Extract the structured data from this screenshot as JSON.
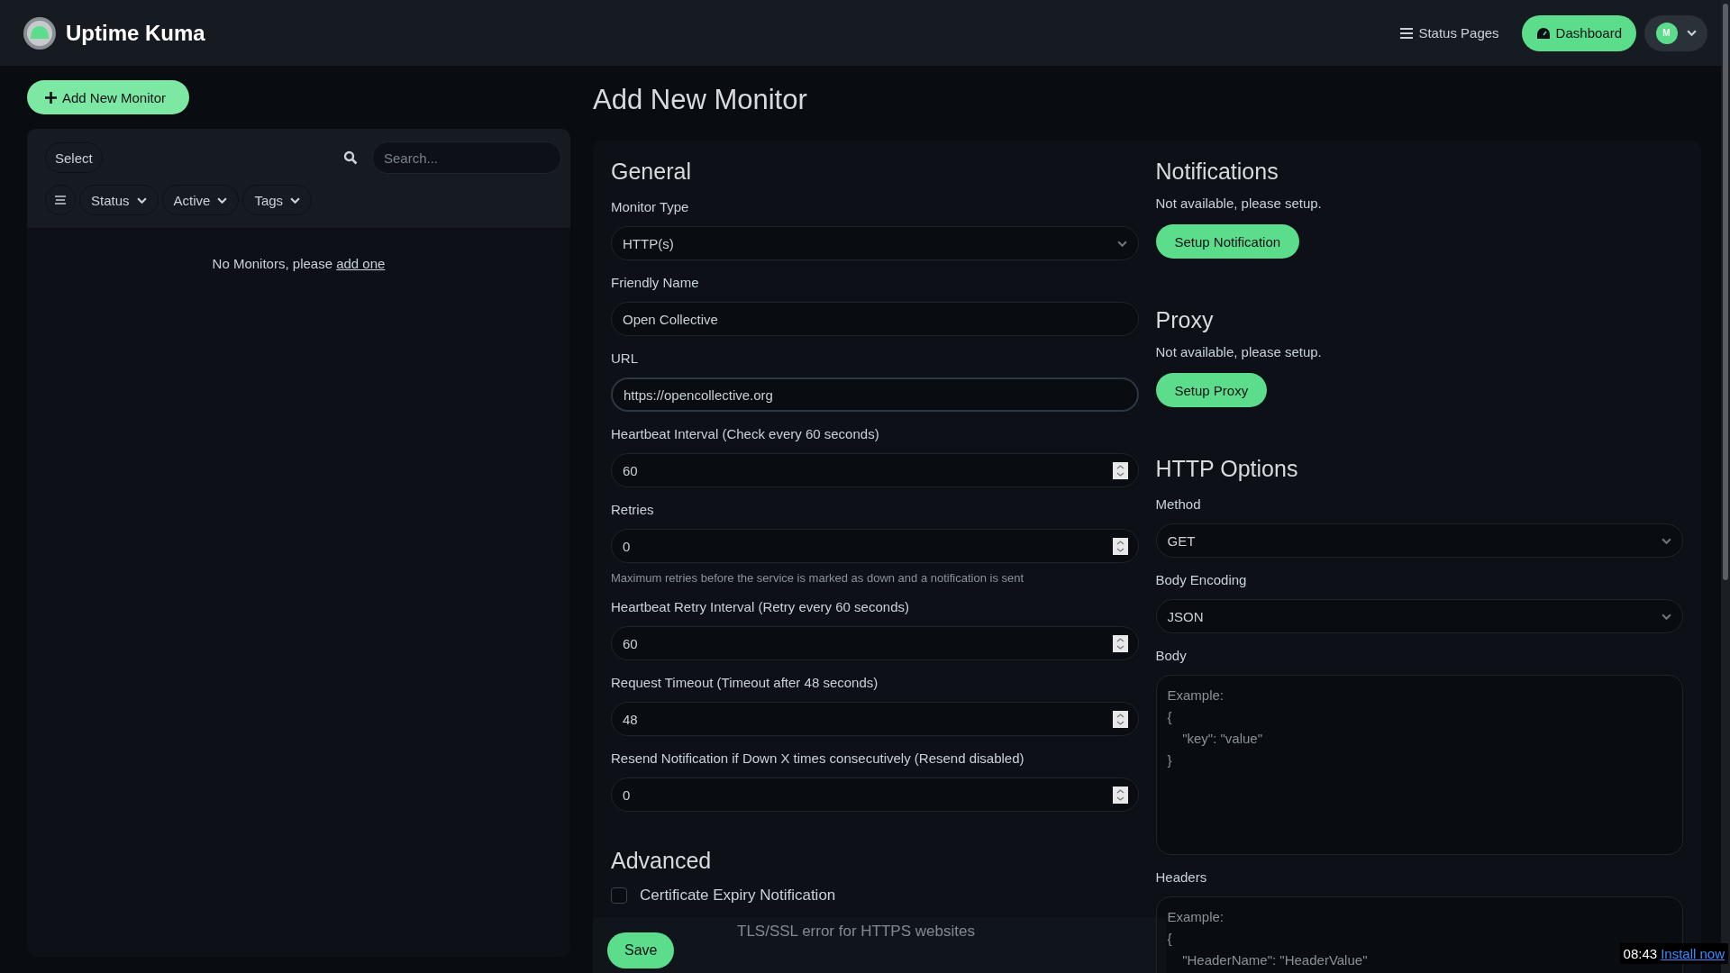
{
  "header": {
    "brand": "Uptime Kuma",
    "status_pages": "Status Pages",
    "dashboard": "Dashboard",
    "avatar": "M"
  },
  "sidebar": {
    "add_button": "Add New Monitor",
    "select_button": "Select",
    "search": {
      "placeholder": "Search..."
    },
    "filters": [
      "Status",
      "Active",
      "Tags"
    ],
    "empty_text": "No Monitors, please",
    "empty_link": "add one"
  },
  "page_title": "Add New Monitor",
  "general": {
    "heading": "General",
    "fields": [
      {
        "label": "Monitor Type",
        "kind": "select",
        "value": "HTTP(s)"
      },
      {
        "label": "Friendly Name",
        "kind": "text",
        "value": "Open Collective"
      },
      {
        "label": "URL",
        "kind": "text",
        "value": "https://opencollective.org",
        "focused": true
      },
      {
        "label": "Heartbeat Interval (Check every 60 seconds)",
        "kind": "number",
        "value": "60"
      },
      {
        "label": "Retries",
        "kind": "number",
        "value": "0",
        "hint": "Maximum retries before the service is marked as down and a notification is sent"
      },
      {
        "label": "Heartbeat Retry Interval (Retry every 60 seconds)",
        "kind": "number",
        "value": "60"
      },
      {
        "label": "Request Timeout (Timeout after 48 seconds)",
        "kind": "number",
        "value": "48"
      },
      {
        "label": "Resend Notification if Down X times consecutively (Resend disabled)",
        "kind": "number",
        "value": "0"
      }
    ]
  },
  "advanced": {
    "heading": "Advanced",
    "options": [
      {
        "label": "Certificate Expiry Notification",
        "checked": false
      },
      {
        "label": "TLS/SSL error for HTTPS websites"
      }
    ]
  },
  "notifications": {
    "heading": "Notifications",
    "text": "Not available, please setup.",
    "button": "Setup Notification"
  },
  "proxy": {
    "heading": "Proxy",
    "text": "Not available, please setup.",
    "button": "Setup Proxy"
  },
  "http_options": {
    "heading": "HTTP Options",
    "fields": [
      {
        "label": "Method",
        "kind": "select",
        "value": "GET"
      },
      {
        "label": "Body Encoding",
        "kind": "select",
        "value": "JSON"
      },
      {
        "label": "Body",
        "kind": "textarea",
        "placeholder": "Example:\n{\n    \"key\": \"value\"\n}"
      },
      {
        "label": "Headers",
        "kind": "textarea",
        "placeholder": "Example:\n{\n    \"HeaderName\": \"HeaderValue\""
      }
    ]
  },
  "save_button": "Save",
  "toast": {
    "time": "08:43",
    "link": "Install now"
  }
}
